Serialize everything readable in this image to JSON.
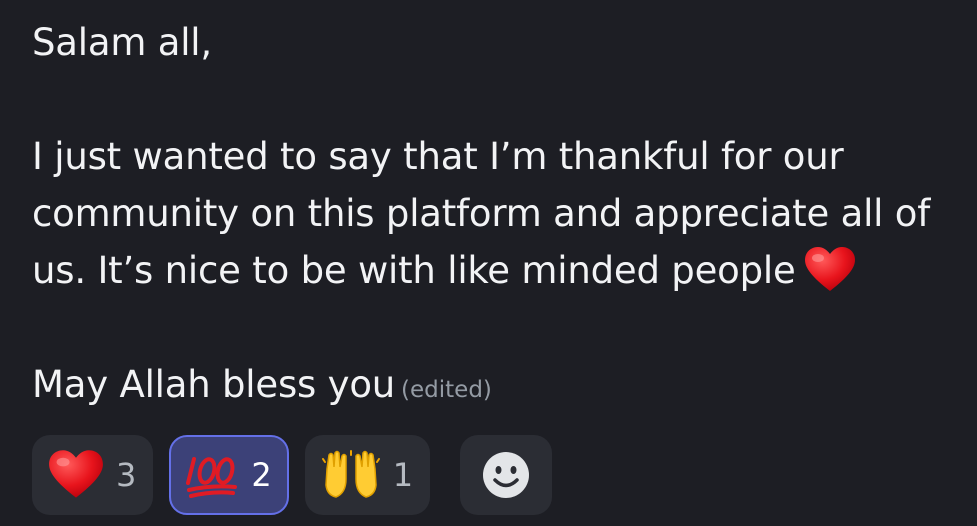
{
  "message": {
    "lines": [
      "Salam all,",
      "",
      "I just wanted to say that I’m thankful for our",
      "community on this platform and appreciate all of",
      "us. It’s nice to be with like minded people",
      "",
      "May Allah bless you"
    ],
    "edited_label": "(edited)",
    "inline_emoji": "heart"
  },
  "reactions": [
    {
      "emoji": "red-heart",
      "count": "3",
      "active": false
    },
    {
      "emoji": "hundred-points",
      "count": "2",
      "active": true
    },
    {
      "emoji": "raising-hands",
      "count": "1",
      "active": false
    }
  ],
  "add_reaction": {
    "icon": "smiley-face"
  },
  "colors": {
    "background": "#1d1e24",
    "text": "#f2f3f5",
    "muted": "#949ba4",
    "pill": "#2b2d34",
    "pill_active": "#3c4178",
    "pill_active_border": "#6470e8"
  }
}
